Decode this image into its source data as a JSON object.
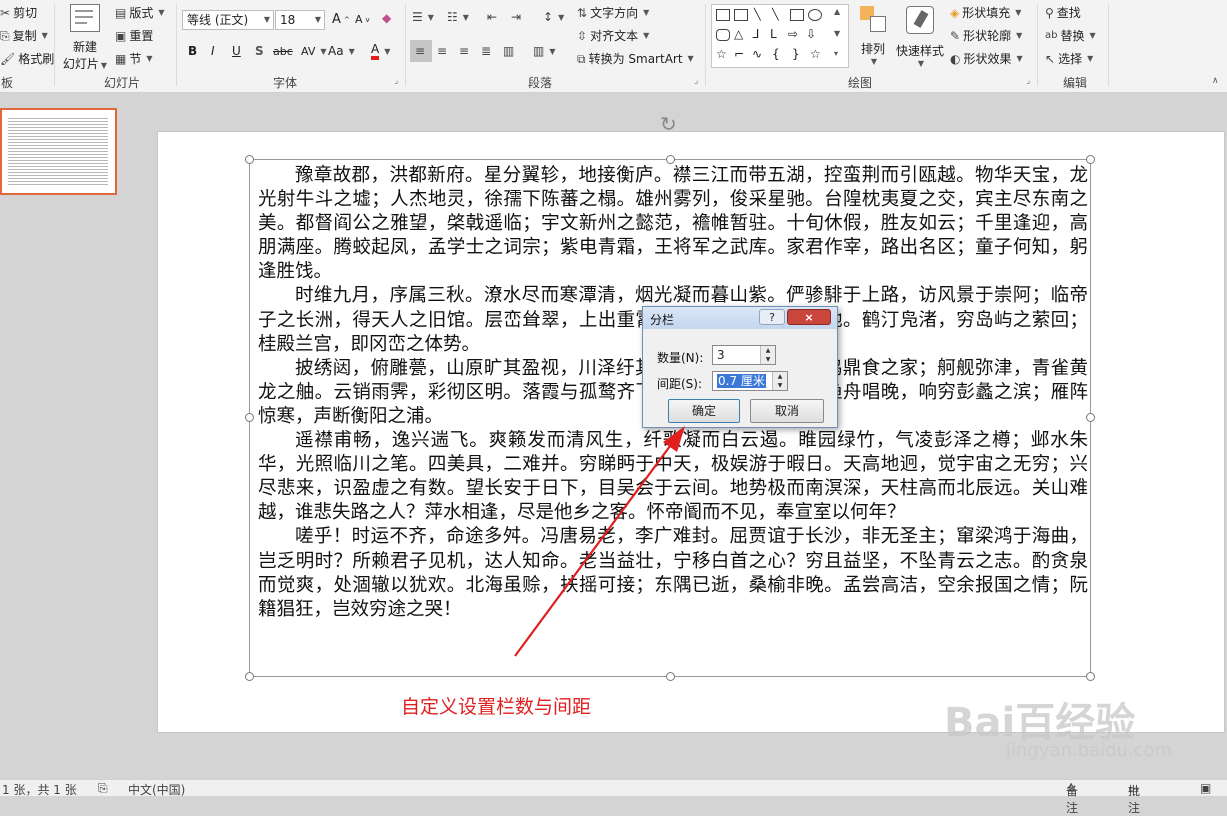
{
  "ribbon": {
    "clipboard": {
      "cut": "剪切",
      "copy": "复制",
      "format_painter": "格式刷",
      "group_label": "板"
    },
    "slides": {
      "new_slide_line1": "新建",
      "new_slide_line2": "幻灯片",
      "layout": "版式",
      "reset": "重置",
      "section": "节",
      "group_label": "幻灯片"
    },
    "font": {
      "font_name": "等线 (正文)",
      "font_size": "18",
      "bold": "B",
      "italic": "I",
      "underline": "U",
      "shadow": "S",
      "strike": "abc",
      "spacing": "AV",
      "case": "Aa",
      "color": "A",
      "grow": "A",
      "shrink": "A",
      "group_label": "字体"
    },
    "paragraph": {
      "text_direction": "文字方向",
      "align_text": "对齐文本",
      "smartart": "转换为 SmartArt",
      "group_label": "段落"
    },
    "drawing": {
      "arrange": "排列",
      "quick_styles": "快速样式",
      "shape_fill": "形状填充",
      "shape_outline": "形状轮廓",
      "shape_effects": "形状效果",
      "group_label": "绘图"
    },
    "editing": {
      "find": "查找",
      "replace": "替换",
      "select": "选择",
      "group_label": "编辑"
    }
  },
  "slide_text": {
    "paragraphs": [
      "豫章故郡，洪都新府。星分翼轸，地接衡庐。襟三江而带五湖，控蛮荆而引瓯越。物华天宝，龙光射牛斗之墟；人杰地灵，徐孺下陈蕃之榻。雄州雾列，俊采星驰。台隍枕夷夏之交，宾主尽东南之美。都督阎公之雅望，棨戟遥临；宇文新州之懿范，襜帷暂驻。十旬休假，胜友如云；千里逢迎，高朋满座。腾蛟起凤，孟学士之词宗；紫电青霜，王将军之武库。家君作宰，路出名区；童子何知，躬逢胜饯。",
      "时维九月，序属三秋。潦水尽而寒潭清，烟光凝而暮山紫。俨骖騑于上路，访风景于崇阿；临帝子之长洲，得天人之旧馆。层峦耸翠，上出重霄；飞阁流丹，下临无地。鹤汀凫渚，穷岛屿之萦回；桂殿兰宫，即冈峦之体势。",
      "披绣闼，俯雕甍，山原旷其盈视，川泽纡其骇瞩。闾阎扑地，钟鸣鼎食之家；舸舰弥津，青雀黄龙之舳。云销雨霁，彩彻区明。落霞与孤鹜齐飞，秋水共长天一色。渔舟唱晚，响穷彭蠡之滨；雁阵惊寒，声断衡阳之浦。",
      "遥襟甫畅，逸兴遄飞。爽籁发而清风生，纤歌凝而白云遏。睢园绿竹，气凌彭泽之樽；邺水朱华，光照临川之笔。四美具，二难并。穷睇眄于中天，极娱游于暇日。天高地迥，觉宇宙之无穷；兴尽悲来，识盈虚之有数。望长安于日下，目吴会于云间。地势极而南溟深，天柱高而北辰远。关山难越，谁悲失路之人？萍水相逢，尽是他乡之客。怀帝阍而不见，奉宣室以何年？",
      "嗟乎！时运不齐，命途多舛。冯唐易老，李广难封。屈贾谊于长沙，非无圣主；窜梁鸿于海曲，岂乏明时？所赖君子见机，达人知命。老当益壮，宁移白首之心？穷且益坚，不坠青云之志。酌贪泉而觉爽，处涸辙以犹欢。北海虽赊，扶摇可接；东隅已逝，桑榆非晚。孟尝高洁，空余报国之情；阮籍猖狂，岂效穷途之哭！"
    ]
  },
  "dialog": {
    "title": "分栏",
    "help": "?",
    "close": "×",
    "count_label": "数量(N):",
    "count_value": "3",
    "spacing_label": "间距(S):",
    "spacing_value": "0.7 厘米",
    "ok": "确定",
    "cancel": "取消"
  },
  "annotation": {
    "caption": "自定义设置栏数与间距",
    "color": "#e02020"
  },
  "watermark": {
    "brand": "Bai百经验",
    "site": "jingyan.baidu.com"
  },
  "status": {
    "slide_info": "1 张，共 1 张",
    "language": "中文(中国)",
    "notes": "备注",
    "comments": "批注"
  }
}
